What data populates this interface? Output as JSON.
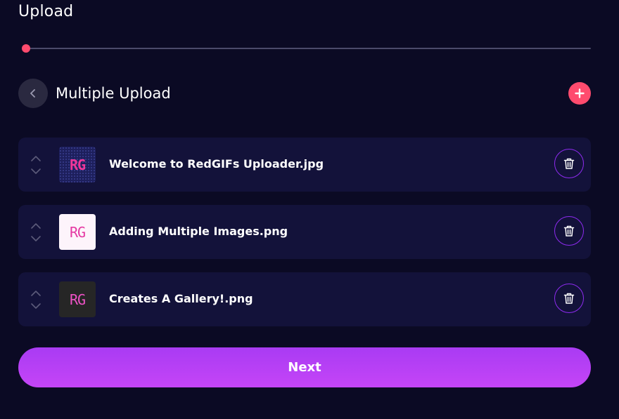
{
  "header": {
    "title": "Upload"
  },
  "progress": {
    "step": 1,
    "fraction": 0.0
  },
  "section": {
    "title": "Multiple Upload"
  },
  "colors": {
    "background": "#0b0a24",
    "row_background": "#13123a",
    "accent_red": "#ff4b6e",
    "accent_purple": "#a93bf3",
    "delete_border": "#8e2bf0"
  },
  "icons": {
    "back": "chevron-left-icon",
    "add": "plus-icon",
    "reorder_up": "chevron-up-icon",
    "reorder_down": "chevron-down-icon",
    "delete": "trash-icon"
  },
  "files": [
    {
      "name": "Welcome to RedGIFs Uploader.jpg",
      "thumb_text": "RG"
    },
    {
      "name": "Adding Multiple Images.png",
      "thumb_text": "RG"
    },
    {
      "name": "Creates A Gallery!.png",
      "thumb_text": "RG"
    }
  ],
  "actions": {
    "next_label": "Next"
  }
}
